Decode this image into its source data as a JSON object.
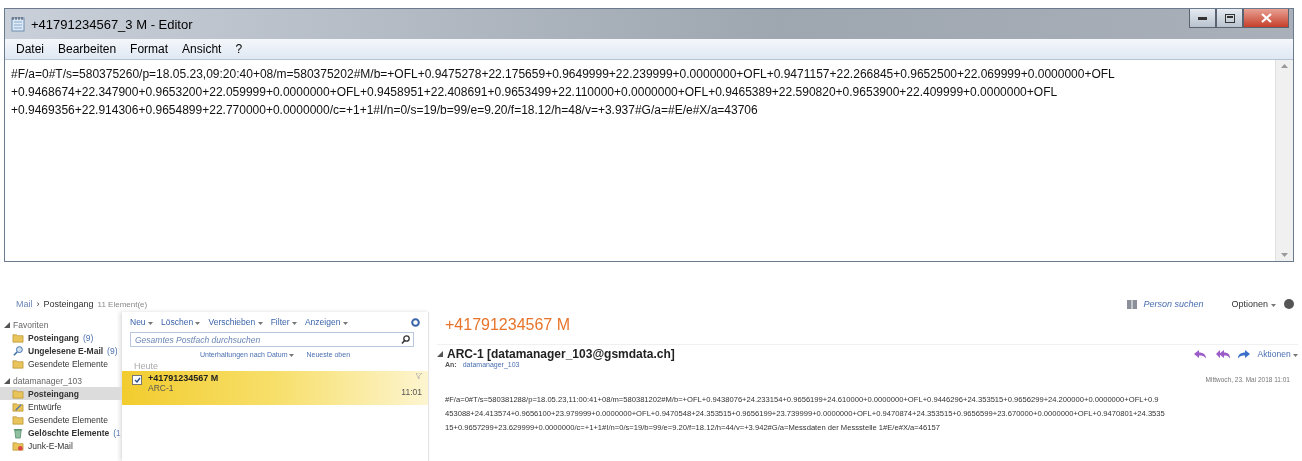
{
  "editor": {
    "title": "+41791234567_3 M - Editor",
    "menu": [
      "Datei",
      "Bearbeiten",
      "Format",
      "Ansicht",
      "?"
    ],
    "lines": [
      "#F/a=0#T/s=580375260/p=18.05.23,09:20:40+08/m=580375202#M/b=+OFL+0.9475278+22.175659+0.9649999+22.239999+0.0000000+OFL+0.9471157+22.266845+0.9652500+22.069999+0.0000000+OFL",
      "+0.9468674+22.347900+0.9653200+22.059999+0.0000000+OFL+0.9458951+22.408691+0.9653499+22.110000+0.0000000+OFL+0.9465389+22.590820+0.9653900+22.409999+0.0000000+OFL",
      "+0.9469356+22.914306+0.9654899+22.770000+0.0000000/c=+1+1#I/n=0/s=19/b=99/e=9.20/f=18.12/h=48/v=+3.937#G/a=#E/e#X/a=43706"
    ]
  },
  "mail": {
    "breadcrumb": {
      "root": "Mail",
      "separator": "›",
      "folder": "Posteingang",
      "count": "11 Element(e)"
    },
    "top_links": {
      "find_person": "Person suchen",
      "options": "Optionen"
    },
    "nav": [
      {
        "label": "Favoriten",
        "expanded": true,
        "children": [
          {
            "label": "Posteingang",
            "count": "(9)",
            "bold": true,
            "selected": false,
            "kind": "folder"
          },
          {
            "label": "Ungelesene E-Mail",
            "count": "(9)",
            "bold": true,
            "selected": false,
            "kind": "search"
          },
          {
            "label": "Gesendete Elemente",
            "bold": false,
            "selected": false,
            "kind": "folder"
          }
        ]
      },
      {
        "label": "datamanager_103",
        "expanded": true,
        "children": [
          {
            "label": "Posteingang",
            "bold": true,
            "selected": true,
            "kind": "folder"
          },
          {
            "label": "Entwürfe",
            "bold": false,
            "selected": false,
            "kind": "draft"
          },
          {
            "label": "Gesendete Elemente",
            "bold": false,
            "selected": false,
            "kind": "folder"
          },
          {
            "label": "Gelöschte Elemente",
            "count": "(1",
            "bold": true,
            "selected": false,
            "kind": "trash"
          },
          {
            "label": "Junk-E-Mail",
            "bold": false,
            "selected": false,
            "kind": "junk"
          }
        ]
      }
    ],
    "toolbar": [
      "Neu",
      "Löschen",
      "Verschieben",
      "Filter",
      "Anzeigen"
    ],
    "search": {
      "placeholder": "Gesamtes Postfach durchsuchen"
    },
    "sort": {
      "by": "Unterhaltungen nach Datum",
      "order": "Neueste oben"
    },
    "group": "Heute",
    "messages": [
      {
        "sender": "+41791234567 M",
        "subject": "ARC-1",
        "time": "11:01",
        "selected": true,
        "checked": true
      }
    ],
    "reading": {
      "title": "+41791234567 M",
      "subject": "ARC-1 [datamanager_103@gsmdata.ch]",
      "to_label": "An:",
      "to": "datamanager_103",
      "actions": "Aktionen",
      "date": "Mittwoch, 23. Mai 2018 11:01",
      "body": [
        "#F/a=0#T/s=580381288/p=18.05.23,11:00:41+08/m=580381202#M/b=+OFL+0.9438076+24.233154+0.9656199+24.610000+0.0000000+OFL+0.9446296+24.353515+0.9656299+24.200000+0.0000000+OFL+0.9",
        "453088+24.413574+0.9656100+23.979999+0.0000000+OFL+0.9470548+24.353515+0.9656199+23.739999+0.0000000+OFL+0.9470874+24.353515+0.9656599+23.670000+0.0000000+OFL+0.9470801+24.3535",
        "15+0.9657299+23.629999+0.0000000/c=+1+1#I/n=0/s=19/b=99/e=9.20/f=18.12/h=44/v=+3.942#G/a=Messdaten der Messstelle 1#E/e#X/a=46157"
      ]
    }
  }
}
